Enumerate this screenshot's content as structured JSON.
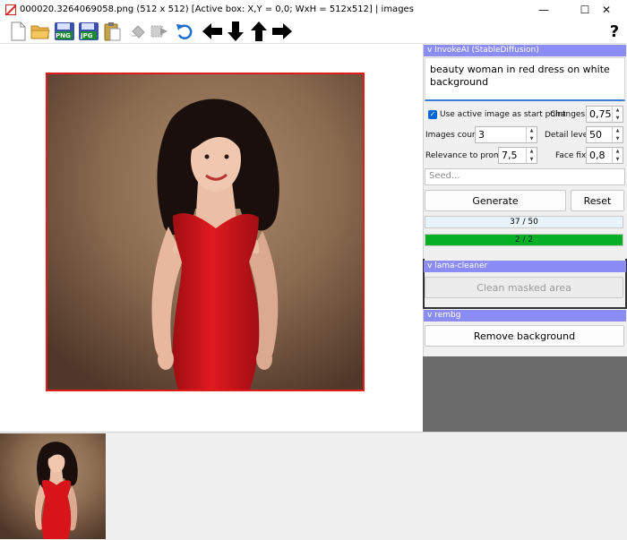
{
  "window": {
    "title": "000020.3264069058.png (512 x 512) [Active box: X,Y = 0,0; WxH = 512x512] | images",
    "controls": {
      "minimize": "—",
      "maximize": "☐",
      "close": "✕"
    }
  },
  "toolbar": {
    "png_label": "PNG",
    "jpg_label": "JPG",
    "help_label": "?"
  },
  "invokeai": {
    "header": "v InvokeAI (StableDiffusion)",
    "prompt": "beauty woman in red dress on white background",
    "use_active_label": "Use active image as start point",
    "use_active_checked": true,
    "changes_label": "Changes",
    "changes_value": "0,75",
    "images_count_label": "Images count",
    "images_count_value": "3",
    "detail_level_label": "Detail level",
    "detail_level_value": "50",
    "relevance_label": "Relevance to prompt",
    "relevance_value": "7,5",
    "face_fix_label": "Face fix",
    "face_fix_value": "0,8",
    "seed_placeholder": "Seed...",
    "generate_label": "Generate",
    "reset_label": "Reset",
    "progress_steps": "37 / 50",
    "progress_images": "2 / 2"
  },
  "lama": {
    "header": "v lama-cleaner",
    "clean_label": "Clean masked area"
  },
  "rembg": {
    "header": "v rembg",
    "remove_label": "Remove background"
  },
  "colors": {
    "accent": "#8c8cf5",
    "selection_border": "#e21b1b",
    "progress_green": "#06b025",
    "dress_red": "#d8141b"
  }
}
